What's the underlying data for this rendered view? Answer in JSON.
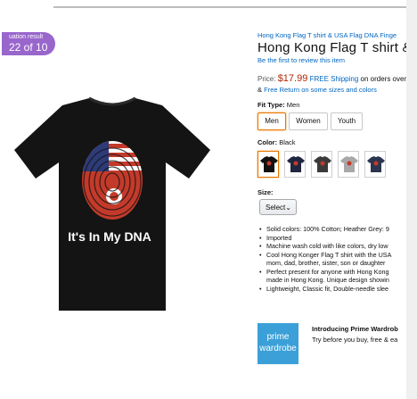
{
  "badge": {
    "line1": "uation result",
    "line2": "22 of 10"
  },
  "product": {
    "breadcrumb": "Hong Kong Flag T shirt & USA Flag DNA Finge",
    "title": "Hong Kong Flag T shirt & US",
    "review_link": "Be the first to review this item",
    "image_text": "It's In My DNA"
  },
  "price": {
    "label": "Price:",
    "amount": "$17.99",
    "free_shipping": "FREE Shipping",
    "shipping_rest": "on orders over",
    "return_prefix": "&",
    "return_link": "Free Return on some sizes and colors"
  },
  "fit": {
    "label": "Fit Type:",
    "value": "Men",
    "options": [
      "Men",
      "Women",
      "Youth"
    ]
  },
  "color": {
    "label": "Color:",
    "value": "Black",
    "swatches": [
      "#121212",
      "#1e2640",
      "#3a3a3a",
      "#a8a8a8",
      "#2b3550"
    ]
  },
  "size": {
    "label": "Size:",
    "select_value": "Select"
  },
  "bullets": [
    "Solid colors: 100% Cotton; Heather Grey: 9",
    "Imported",
    "Machine wash cold with like colors, dry low",
    "Cool Hong Konger Flag T shirt with the USA",
    "mom, dad, brother, sister, son or daughter",
    "Perfect present for anyone with Hong Kong",
    "made in Hong Kong. Unique design showin",
    "Lightweight, Classic fit, Double-needle slee"
  ],
  "wardrobe": {
    "logo_line1": "prime",
    "logo_line2": "wardrobe",
    "title": "Introducing Prime Wardrob",
    "desc": "Try before you buy, free & ea"
  }
}
